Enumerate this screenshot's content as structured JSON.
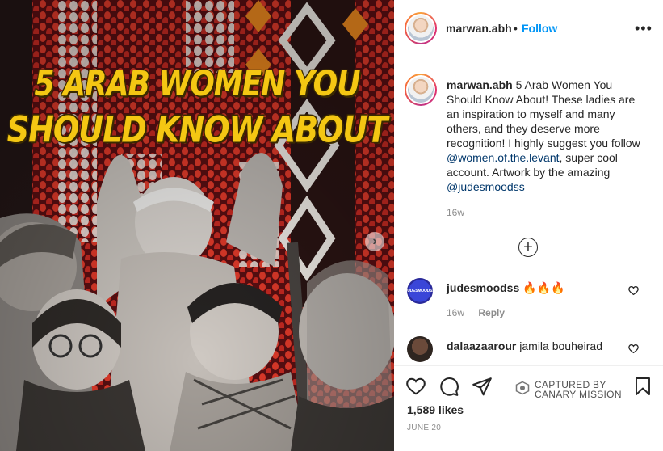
{
  "post": {
    "headline_line1": "5 ARAB WOMEN YOU",
    "headline_line2": "SHOULD KNOW ABOUT",
    "next_icon": "chevron-right-icon"
  },
  "header": {
    "username": "marwan.abh",
    "separator": "•",
    "follow_label": "Follow",
    "more_icon": "more-horizontal-icon"
  },
  "caption": {
    "username": "marwan.abh",
    "text_part1": "5 Arab Women You Should Know About! These ladies are an inspiration to myself and many others, and they deserve more recognition! I highly suggest you follow ",
    "mention1": "@women.of.the.levant",
    "text_part2": ", super cool account. Artwork by the amazing ",
    "mention2": "@judesmoodss",
    "time": "16w"
  },
  "load_more_icon": "plus-circle-icon",
  "comments": [
    {
      "username": "judesmoodss",
      "text": "🔥🔥🔥",
      "time": "16w",
      "reply_label": "Reply",
      "avatar_text": "JUDESMOODSS"
    },
    {
      "username": "dalaazaarour",
      "text": "jamila bouheirad"
    }
  ],
  "actions": {
    "like_icon": "heart-icon",
    "comment_icon": "comment-icon",
    "share_icon": "share-icon",
    "save_icon": "bookmark-icon",
    "watermark_line1": "CAPTURED BY",
    "watermark_line2": "CANARY MISSION",
    "likes": "1,589 likes",
    "date": "JUNE 20"
  },
  "colors": {
    "link_blue": "#0095f6",
    "mention_blue": "#00376b",
    "headline_yellow": "#f4c713",
    "muted_gray": "#8e8e8e"
  }
}
